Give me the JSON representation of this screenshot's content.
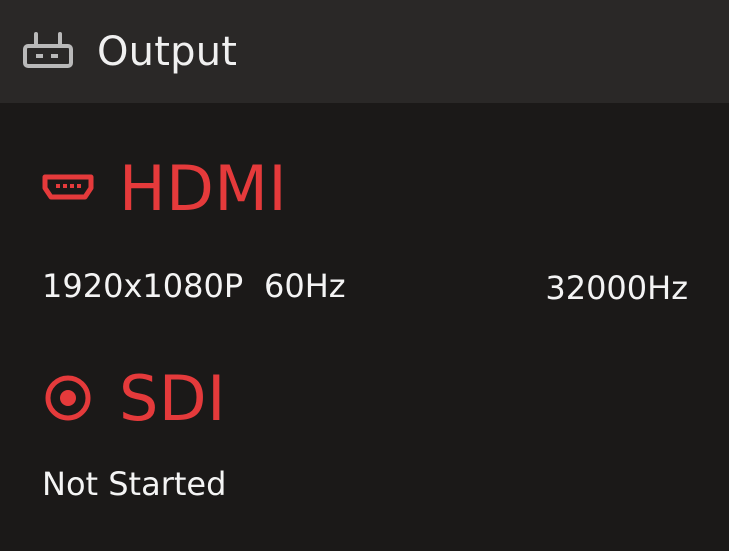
{
  "header": {
    "title": "Output",
    "icon": "router-icon"
  },
  "hdmi": {
    "label": "HDMI",
    "icon": "hdmi-port-icon",
    "resolution": "1920x1080P",
    "frame_rate": "60Hz",
    "audio_rate": "32000Hz"
  },
  "sdi": {
    "label": "SDI",
    "icon": "radio-target-icon",
    "status": "Not Started"
  },
  "colors": {
    "background": "#1b1918",
    "header_background": "#2a2827",
    "accent_red": "#e53a3b",
    "text": "#f4f4f4",
    "icon_gray": "#b9b9b9"
  }
}
